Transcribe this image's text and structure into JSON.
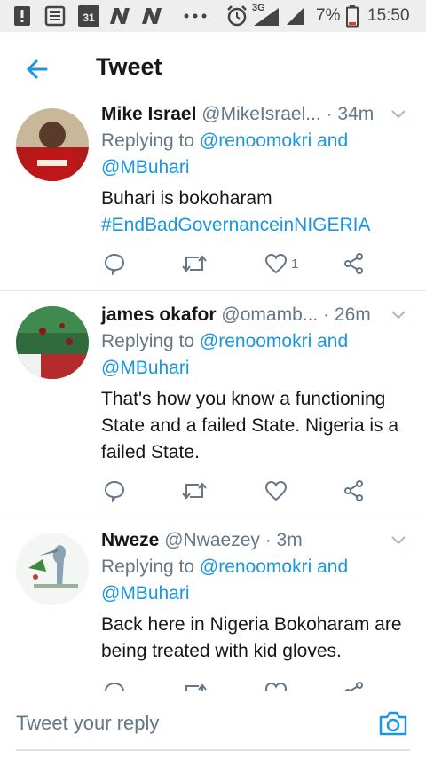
{
  "status_bar": {
    "calendar_day": "31",
    "network": "3G",
    "battery": "7%",
    "time": "15:50"
  },
  "header": {
    "title": "Tweet"
  },
  "tweets": [
    {
      "name": "Mike Israel",
      "handle": "@MikeIsrael...",
      "time": "· 34m",
      "replying_prefix": "Replying to ",
      "replying_to_1": "@renoomokri",
      "replying_and": " and",
      "replying_to_2": "@MBuhari",
      "text_lines": [
        "Buhari is bokoharam"
      ],
      "hashtag": "#EndBadGovernanceinNIGERIA",
      "like_count": "1"
    },
    {
      "name": "james okafor",
      "handle": "@omamb...",
      "time": "· 26m",
      "replying_prefix": "Replying to ",
      "replying_to_1": "@renoomokri",
      "replying_and": " and",
      "replying_to_2": "@MBuhari",
      "text_lines": [
        "That's how you know a functioning",
        "State and a failed State. Nigeria is a",
        "failed State."
      ],
      "like_count": ""
    },
    {
      "name": "Nweze",
      "handle": "@Nwaezey",
      "time": "· 3m",
      "replying_prefix": "Replying to ",
      "replying_to_1": "@renoomokri",
      "replying_and": " and",
      "replying_to_2": "@MBuhari",
      "text_lines": [
        "Back here in Nigeria Bokoharam are",
        "being treated with kid gloves."
      ],
      "like_count": ""
    }
  ],
  "composer": {
    "placeholder": "Tweet your reply"
  },
  "colors": {
    "accent": "#1b95e0",
    "muted": "#657786",
    "text": "#14171a",
    "divider": "#e1e8ed"
  },
  "icons": [
    "notification-icon",
    "news-icon",
    "calendar-icon",
    "n-app-icon",
    "more-icon",
    "alarm-icon",
    "signal-icon",
    "battery-icon",
    "back-arrow-icon",
    "chevron-down-icon",
    "reply-icon",
    "retweet-icon",
    "like-icon",
    "share-icon",
    "camera-icon"
  ]
}
